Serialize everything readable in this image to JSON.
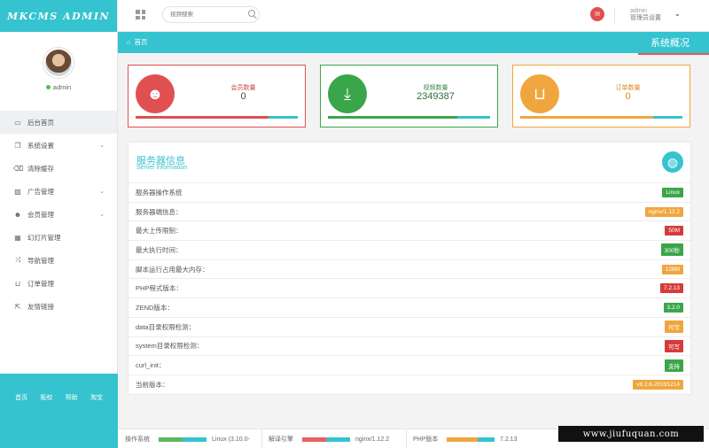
{
  "app": {
    "logo": "MKCMS ADMIN"
  },
  "user": {
    "name": "admin"
  },
  "sidebar": {
    "items": [
      {
        "label": "后台首页",
        "icon": "laptop-icon",
        "glyph": "▭",
        "expandable": false,
        "active": true
      },
      {
        "label": "系统设置",
        "icon": "copy-icon",
        "glyph": "❐",
        "expandable": true,
        "active": false
      },
      {
        "label": "清除缓存",
        "icon": "trash-icon",
        "glyph": "⌫",
        "expandable": false,
        "active": false
      },
      {
        "label": "广告管理",
        "icon": "image-icon",
        "glyph": "▨",
        "expandable": true,
        "active": false
      },
      {
        "label": "会员管理",
        "icon": "users-icon",
        "glyph": "☻",
        "expandable": true,
        "active": false
      },
      {
        "label": "幻灯片管理",
        "icon": "table-icon",
        "glyph": "▦",
        "expandable": false,
        "active": false
      },
      {
        "label": "导航管理",
        "icon": "random-icon",
        "glyph": "⤨",
        "expandable": false,
        "active": false
      },
      {
        "label": "订单管理",
        "icon": "cart-icon",
        "glyph": "⊔",
        "expandable": false,
        "active": false
      },
      {
        "label": "友情链接",
        "icon": "external-link-icon",
        "glyph": "⇱",
        "expandable": false,
        "active": false
      }
    ],
    "footer_links": [
      "首页",
      "板权",
      "帮助",
      "淘宝"
    ]
  },
  "topbar": {
    "search_placeholder": "视频搜索",
    "admin_name": "admin",
    "admin_role": "管理员设置"
  },
  "breadcrumb": {
    "home": "首页",
    "page_title": "系统概况"
  },
  "stats": [
    {
      "label": "会员数量",
      "value": "0",
      "progress": 0.82
    },
    {
      "label": "视频数量",
      "value": "2349387",
      "progress": 0.8
    },
    {
      "label": "订单数量",
      "value": "0",
      "progress": 0.82
    }
  ],
  "server": {
    "title": "服务器信息",
    "subtitle": "Server information",
    "rows": [
      {
        "label": "服务器操作系统",
        "value": "Linux",
        "color": "green"
      },
      {
        "label": "服务器端信息：",
        "value": "nginx/1.12.2",
        "color": "orange"
      },
      {
        "label": "最大上传限制：",
        "value": "50M",
        "color": "red"
      },
      {
        "label": "最大执行时间：",
        "value": "300秒",
        "color": "green"
      },
      {
        "label": "脚本运行占用最大内存：",
        "value": "128M",
        "color": "orange"
      },
      {
        "label": "PHP程式版本：",
        "value": "7.2.13",
        "color": "red"
      },
      {
        "label": "ZEND版本：",
        "value": "3.2.0",
        "color": "green"
      },
      {
        "label": "data目录权限检测：",
        "value": "可写",
        "color": "orange"
      },
      {
        "label": "system目录权限检测：",
        "value": "可写",
        "color": "red"
      },
      {
        "label": "curl_init：",
        "value": "支持",
        "color": "green"
      },
      {
        "label": "当前版本：",
        "value": "v6.2.6-20191214",
        "color": "orange"
      }
    ]
  },
  "footer": {
    "items": [
      {
        "label": "操作系统",
        "value": "Linux (3.10.0-",
        "fill_color": "#5cb85c",
        "progress": 0.5
      },
      {
        "label": "解译引擎",
        "value": "nginx/1.12.2",
        "fill_color": "#e86060",
        "progress": 0.5
      },
      {
        "label": "PHP版本",
        "value": "7.2.13",
        "fill_color": "#f0a63e",
        "progress": 0.65
      }
    ]
  },
  "watermark": "www.jiufuquan.com",
  "colors": {
    "accent": "#35c3cf",
    "green": "#3aa64a",
    "orange": "#f0a63e",
    "red": "#d63b3b"
  }
}
